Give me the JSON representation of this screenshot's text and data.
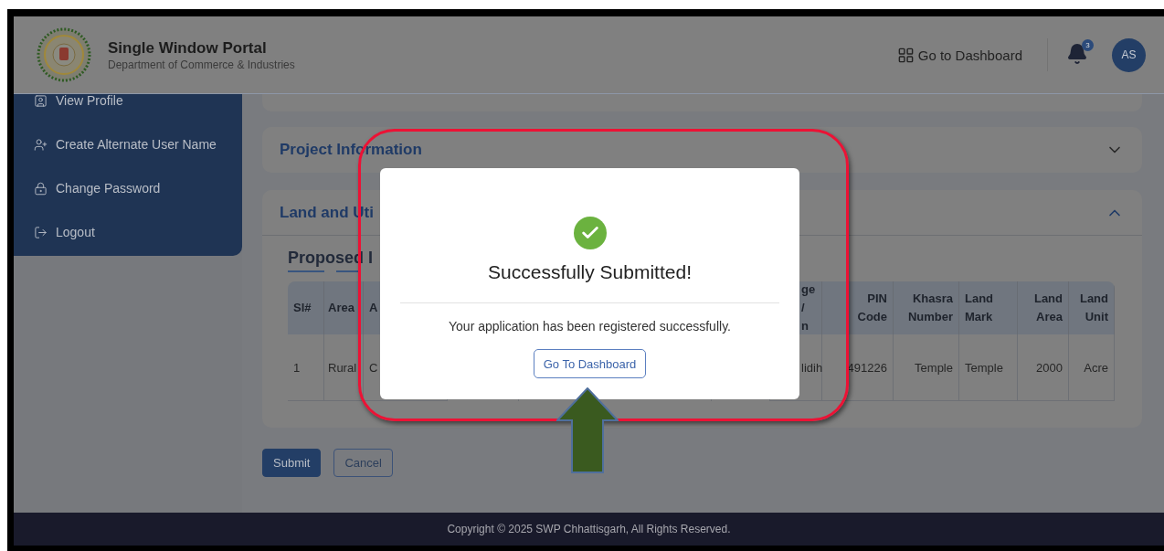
{
  "header": {
    "title": "Single Window Portal",
    "subtitle": "Department of Commerce & Industries",
    "dashboard_link": "Go to Dashboard",
    "notification_count": "3",
    "avatar_initials": "AS"
  },
  "sidebar": {
    "items": [
      {
        "label": "View Profile",
        "kind": "profile"
      },
      {
        "label": "Create Alternate User Name",
        "kind": "user"
      },
      {
        "label": "Change Password",
        "kind": "password"
      },
      {
        "label": "Logout",
        "kind": "logout"
      }
    ]
  },
  "sections": [
    {
      "title": "Project Information",
      "expanded": false
    },
    {
      "title": "Land and Uti",
      "expanded": true
    }
  ],
  "land": {
    "subtitle": "Proposed I",
    "columns": [
      {
        "label": "Sl#"
      },
      {
        "label": "Area"
      },
      {
        "label": "A"
      },
      {
        "label": "ge /\nn"
      },
      {
        "label": "PIN\nCode"
      },
      {
        "label": "Khasra\nNumber"
      },
      {
        "label": "Land\nMark"
      },
      {
        "label": "Land\nArea"
      },
      {
        "label": "Land\nUnit"
      }
    ],
    "rows": [
      [
        "1",
        "Rural",
        "C",
        "lidih",
        "491226",
        "Temple",
        "Temple",
        "2000",
        "Acre"
      ]
    ]
  },
  "actions": [
    "Submit",
    "Cancel"
  ],
  "footer": "Copyright © 2025 SWP Chhattisgarh, All Rights Reserved.",
  "modal": {
    "title": "Successfully Submitted!",
    "message": "Your application has been registered successfully.",
    "button": "Go To Dashboard"
  }
}
